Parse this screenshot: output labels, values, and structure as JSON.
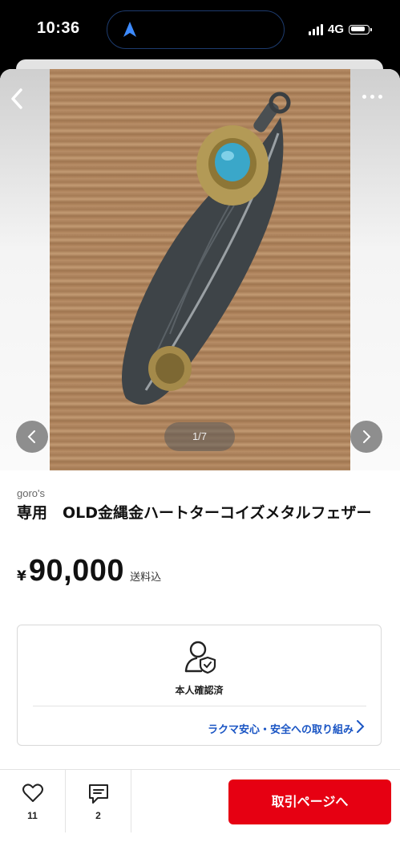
{
  "status_bar": {
    "time": "10:36",
    "network": "4G"
  },
  "gallery": {
    "counter": "1/7"
  },
  "product": {
    "brand": "goro's",
    "title": "専用　OLD金縄金ハートターコイズメタルフェザー",
    "price_symbol": "¥",
    "price": "90,000",
    "shipping": "送料込"
  },
  "verification": {
    "label": "本人確認済",
    "link": "ラクマ安心・安全への取り組み"
  },
  "actions": {
    "like_count": "11",
    "comment_count": "2",
    "trade_button": "取引ページへ"
  },
  "colors": {
    "accent_red": "#e60012",
    "link_blue": "#1a55c4"
  },
  "icons": [
    "navigation-arrow-icon",
    "back-icon",
    "more-icon",
    "chevron-left-icon",
    "chevron-right-icon",
    "verified-user-icon",
    "heart-icon",
    "comment-icon"
  ]
}
